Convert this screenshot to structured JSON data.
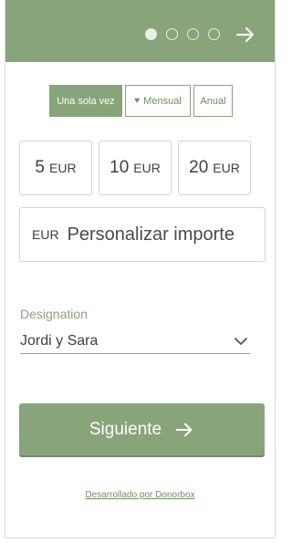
{
  "header": {
    "steps": [
      {
        "state": "active"
      },
      {
        "state": "inactive"
      },
      {
        "state": "inactive"
      },
      {
        "state": "inactive"
      }
    ],
    "next_icon": "arrow-right-icon"
  },
  "frequency": {
    "once_label": "Una sola vez",
    "monthly_label": "Mensual",
    "monthly_icon": "heart-icon",
    "annual_label": "Anual",
    "selected": "once"
  },
  "amounts": [
    {
      "value": "5",
      "currency": "EUR"
    },
    {
      "value": "10",
      "currency": "EUR"
    },
    {
      "value": "20",
      "currency": "EUR"
    }
  ],
  "custom_amount": {
    "currency": "EUR",
    "placeholder": "Personalizar importe"
  },
  "designation": {
    "label": "Designation",
    "value": "Jordi y Sara",
    "icon": "chevron-down-icon"
  },
  "next_button": {
    "label": "Siguiente",
    "icon": "arrow-right-icon"
  },
  "footer": {
    "powered_by": "Desarrollado por Donorbox"
  },
  "colors": {
    "accent": "#87a47a",
    "border": "#d4d4d4"
  }
}
